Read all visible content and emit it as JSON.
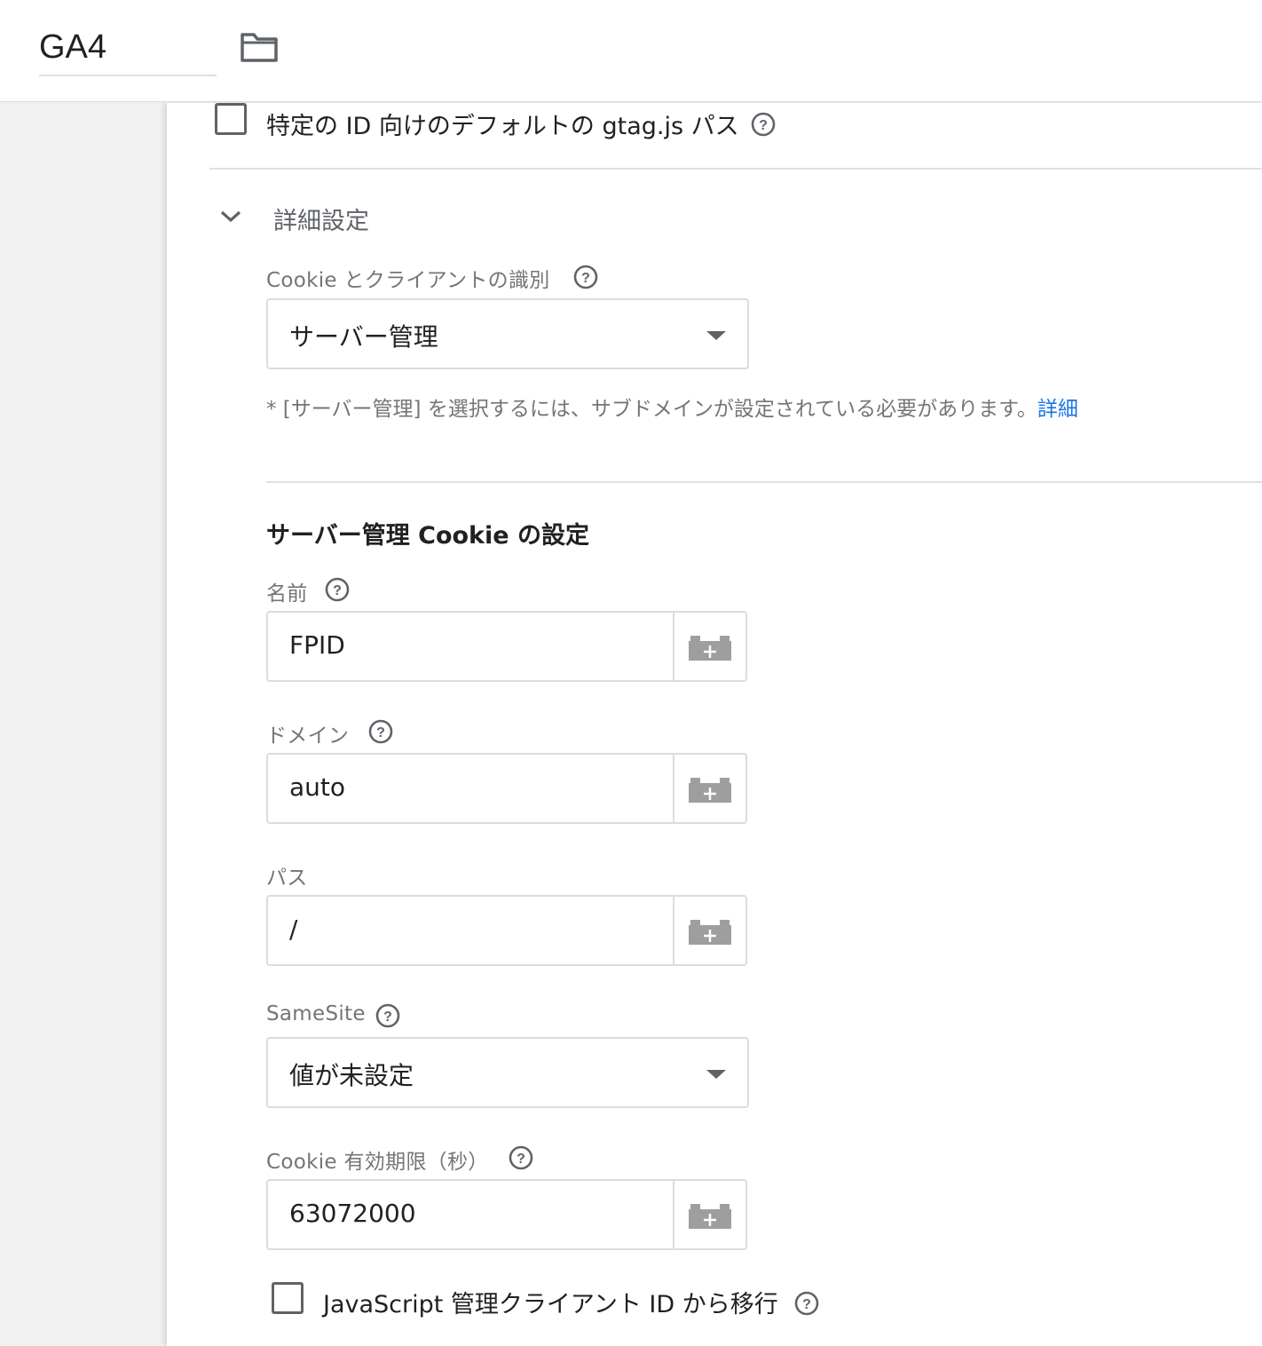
{
  "header": {
    "title": "GA4"
  },
  "icons": {
    "folder": "folder-icon",
    "help": "help-circle-icon",
    "chevron": "chevron-down-icon",
    "variable": "add-variable-icon"
  },
  "gtag_path": {
    "label": "特定の ID 向けのデフォルトの gtag.js パス",
    "checked": false
  },
  "advanced": {
    "title": "詳細設定",
    "expanded": true,
    "cookie_client_id": {
      "label": "Cookie とクライアントの識別",
      "selected": "サーバー管理"
    },
    "note": {
      "text": "* [サーバー管理] を選択するには、サブドメインが設定されている必要があります。",
      "link": "詳細"
    },
    "server_cookie_settings": {
      "title": "サーバー管理 Cookie の設定",
      "name": {
        "label": "名前",
        "value": "FPID"
      },
      "domain": {
        "label": "ドメイン",
        "value": "auto"
      },
      "path": {
        "label": "パス",
        "value": "/"
      },
      "samesite": {
        "label": "SameSite",
        "selected": "値が未設定"
      },
      "expiry": {
        "label": "Cookie 有効期限（秒）",
        "value": "63072000"
      },
      "migrate": {
        "label": "JavaScript 管理クライアント ID から移行",
        "checked": false
      }
    }
  },
  "colors": {
    "link": "#1a73e8",
    "icon_gray": "#5f6368",
    "border": "#dadce0"
  }
}
